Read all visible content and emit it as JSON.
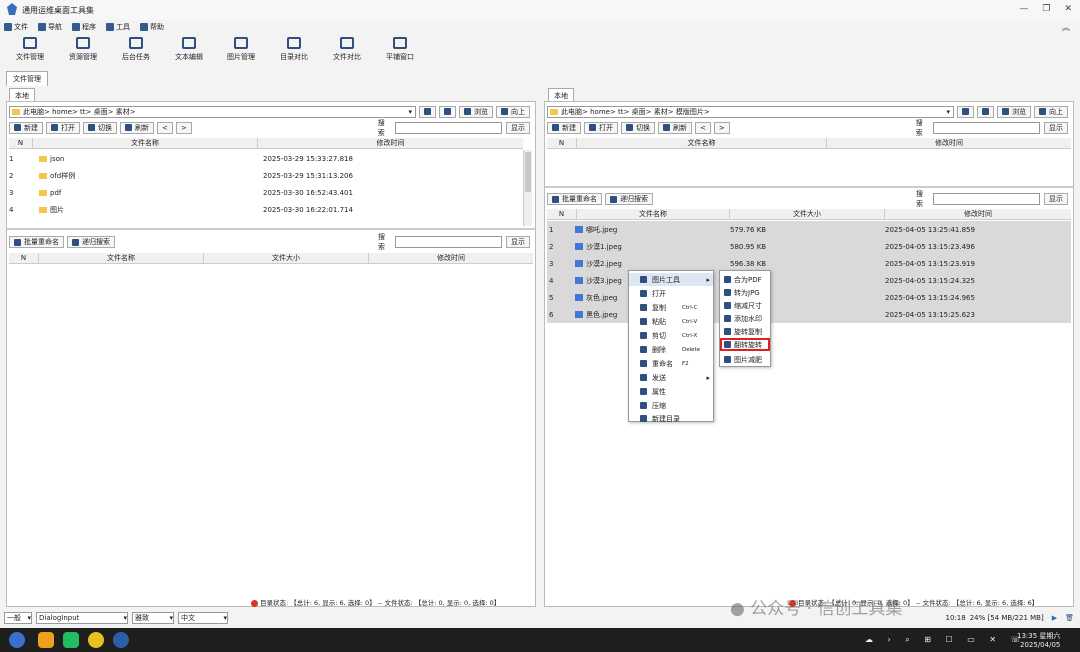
{
  "window": {
    "title": "通用运维桌面工具集",
    "controls": [
      "—",
      "❐",
      "✕"
    ]
  },
  "menubar": [
    "文件",
    "导航",
    "程序",
    "工具",
    "帮助"
  ],
  "toolbar": [
    "文件管理",
    "资源管理",
    "后台任务",
    "文本编辑",
    "图片管理",
    "目录对比",
    "文件对比",
    "平铺窗口"
  ],
  "main_tab": "文件管理",
  "left": {
    "tab": "本地",
    "path": [
      "此电脑",
      "home",
      "tt",
      "桌面",
      "素材"
    ],
    "nav_buttons": [
      "浏览",
      "向上"
    ],
    "actions": [
      "新建",
      "打开",
      "切换",
      "刷新"
    ],
    "search_label": "搜索",
    "show_button": "显示",
    "columns": [
      "N",
      "文件名称",
      "修改时间"
    ],
    "rows": [
      {
        "n": "1",
        "name": "json",
        "time": "2025-03-29 15:33:27.818"
      },
      {
        "n": "2",
        "name": "ofd样例",
        "time": "2025-03-29 15:31:13.206"
      },
      {
        "n": "3",
        "name": "pdf",
        "time": "2025-03-30 16:52:43.401"
      },
      {
        "n": "4",
        "name": "图片",
        "time": "2025-03-30 16:22:01.714"
      }
    ],
    "lower_actions": [
      "批量重命名",
      "递归搜索"
    ],
    "lower_columns": [
      "N",
      "文件名称",
      "文件大小",
      "修改时间"
    ],
    "status": "目录状态: 【总计: 6, 显示: 6, 选择: 0】 -- 文件状态: 【总计: 0, 显示: 0, 选择: 0】"
  },
  "right": {
    "tab": "本地",
    "path": [
      "此电脑",
      "home",
      "tt",
      "桌面",
      "素材",
      "模版图片"
    ],
    "nav_buttons": [
      "浏览",
      "向上"
    ],
    "actions": [
      "新建",
      "打开",
      "切换",
      "刷新"
    ],
    "search_label": "搜索",
    "show_button": "显示",
    "columns": [
      "N",
      "文件名称",
      "修改时间"
    ],
    "lower_actions": [
      "批量重命名",
      "递归搜索"
    ],
    "lower_columns": [
      "N",
      "文件名称",
      "文件大小",
      "修改时间"
    ],
    "rows": [
      {
        "n": "1",
        "name": "哪吒.jpeg",
        "size": "579.76 KB",
        "time": "2025-04-05 13:25:41.859"
      },
      {
        "n": "2",
        "name": "沙漠1.jpeg",
        "size": "580.95 KB",
        "time": "2025-04-05 13:15:23.496"
      },
      {
        "n": "3",
        "name": "沙漠2.jpeg",
        "size": "596.38 KB",
        "time": "2025-04-05 13:15:23.919"
      },
      {
        "n": "4",
        "name": "沙漠3.jpeg",
        "size": "",
        "time": "2025-04-05 13:15:24.325"
      },
      {
        "n": "5",
        "name": "灰色.jpeg",
        "size": "",
        "time": "2025-04-05 13:15:24.965"
      },
      {
        "n": "6",
        "name": "黑色.jpeg",
        "size": "",
        "time": "2025-04-05 13:15:25.623"
      }
    ],
    "status": "目录状态: 【总计: 0, 显示: 0, 选择: 0】 -- 文件状态: 【总计: 6, 显示: 6, 选择: 6】"
  },
  "context_menu": [
    {
      "label": "图片工具",
      "shortcut": ""
    },
    {
      "label": "打开",
      "shortcut": ""
    },
    {
      "label": "复制",
      "shortcut": "Ctrl-C"
    },
    {
      "label": "粘贴",
      "shortcut": "Ctrl-V"
    },
    {
      "label": "剪切",
      "shortcut": "Ctrl-X"
    },
    {
      "label": "删除",
      "shortcut": "Delete"
    },
    {
      "label": "重命名",
      "shortcut": "F2"
    },
    {
      "label": "发送",
      "shortcut": ""
    },
    {
      "label": "属性",
      "shortcut": ""
    },
    {
      "label": "压缩",
      "shortcut": ""
    },
    {
      "label": "新建目录",
      "shortcut": ""
    }
  ],
  "submenu": [
    "合为PDF",
    "转为JPG",
    "缩减尺寸",
    "添加水印",
    "旋转复制",
    "翻转旋转",
    "图片减肥"
  ],
  "submenu_highlight": "翻转旋转",
  "bottombar": {
    "level": "一般",
    "input": "DialogInput",
    "theme": "雅致",
    "lang": "中文",
    "memory": "24% [54 MB/221 MB]",
    "time_short": "10:18"
  },
  "watermark": "公众号 · 信创工具集",
  "taskbar": {
    "time": "13:35 星期六",
    "date": "2025/04/05"
  },
  "colors": {
    "accent": "#2f4f7f",
    "highlight_border": "#e02020",
    "selected_row": "#d9d9d9"
  }
}
